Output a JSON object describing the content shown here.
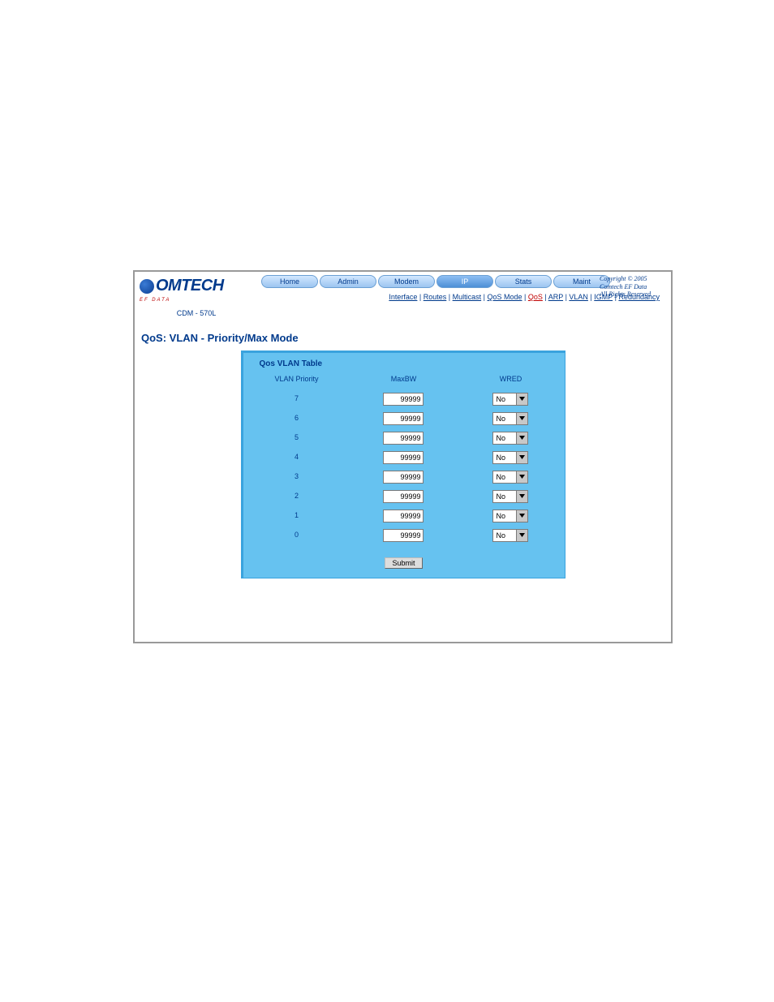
{
  "logo": {
    "brand": "OMTECH",
    "tagline": "EF DATA",
    "model": "CDM - 570L"
  },
  "copyright": {
    "line1": "Copyright © 2005",
    "line2": "Comtech EF Data",
    "line3": "All Rights Reserved"
  },
  "nav": {
    "primary": [
      {
        "label": "Home"
      },
      {
        "label": "Admin"
      },
      {
        "label": "Modem"
      },
      {
        "label": "IP"
      },
      {
        "label": "Stats"
      },
      {
        "label": "Maint"
      }
    ],
    "sub": [
      {
        "label": "Interface"
      },
      {
        "label": "Routes"
      },
      {
        "label": "Multicast"
      },
      {
        "label": "QoS Mode"
      },
      {
        "label": "QoS",
        "current": true
      },
      {
        "label": "ARP"
      },
      {
        "label": "VLAN"
      },
      {
        "label": "IGMP"
      },
      {
        "label": "Redundancy"
      }
    ]
  },
  "page": {
    "title": "QoS: VLAN - Priority/Max Mode"
  },
  "panel": {
    "title": "Qos VLAN Table",
    "headers": {
      "priority": "VLAN Priority",
      "maxbw": "MaxBW",
      "wred": "WRED"
    },
    "rows": [
      {
        "priority": "7",
        "maxbw": "99999",
        "wred": "No"
      },
      {
        "priority": "6",
        "maxbw": "99999",
        "wred": "No"
      },
      {
        "priority": "5",
        "maxbw": "99999",
        "wred": "No"
      },
      {
        "priority": "4",
        "maxbw": "99999",
        "wred": "No"
      },
      {
        "priority": "3",
        "maxbw": "99999",
        "wred": "No"
      },
      {
        "priority": "2",
        "maxbw": "99999",
        "wred": "No"
      },
      {
        "priority": "1",
        "maxbw": "99999",
        "wred": "No"
      },
      {
        "priority": "0",
        "maxbw": "99999",
        "wred": "No"
      }
    ],
    "submit": "Submit"
  }
}
